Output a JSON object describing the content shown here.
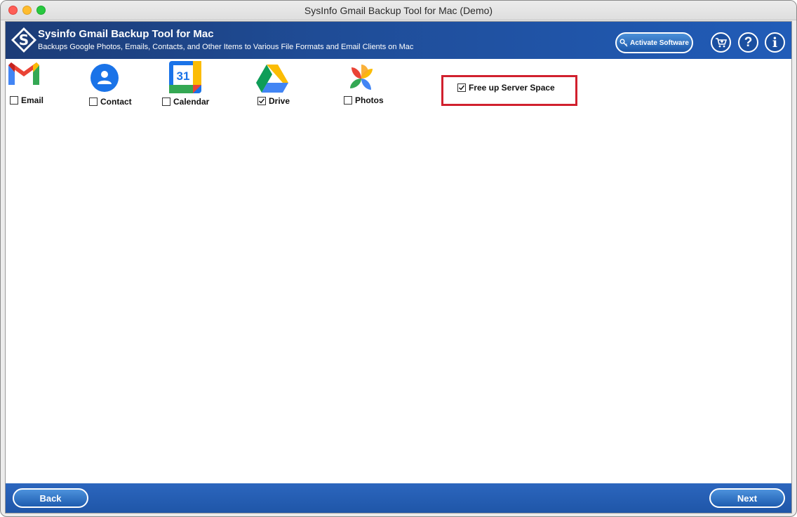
{
  "window": {
    "title": "SysInfo Gmail Backup Tool for Mac (Demo)"
  },
  "header": {
    "title": "Sysinfo Gmail Backup Tool for Mac",
    "subtitle": "Backups Google Photos, Emails, Contacts, and Other Items to Various File Formats and Email Clients on Mac",
    "activate_label": "Activate Software",
    "icons": [
      "cart-icon",
      "help-icon",
      "info-icon"
    ]
  },
  "services": [
    {
      "label": "Email",
      "icon": "gmail-icon",
      "checked": false
    },
    {
      "label": "Contact",
      "icon": "contact-icon",
      "checked": false
    },
    {
      "label": "Calendar",
      "icon": "calendar-icon",
      "checked": false,
      "icon_text": "31"
    },
    {
      "label": "Drive",
      "icon": "drive-icon",
      "checked": true
    },
    {
      "label": "Photos",
      "icon": "photos-icon",
      "checked": false
    }
  ],
  "free_up": {
    "label": "Free up Server Space",
    "checked": true
  },
  "footer": {
    "back_label": "Back",
    "next_label": "Next"
  },
  "colors": {
    "header_blue": "#1f4c96",
    "highlight_red": "#d1202e"
  }
}
